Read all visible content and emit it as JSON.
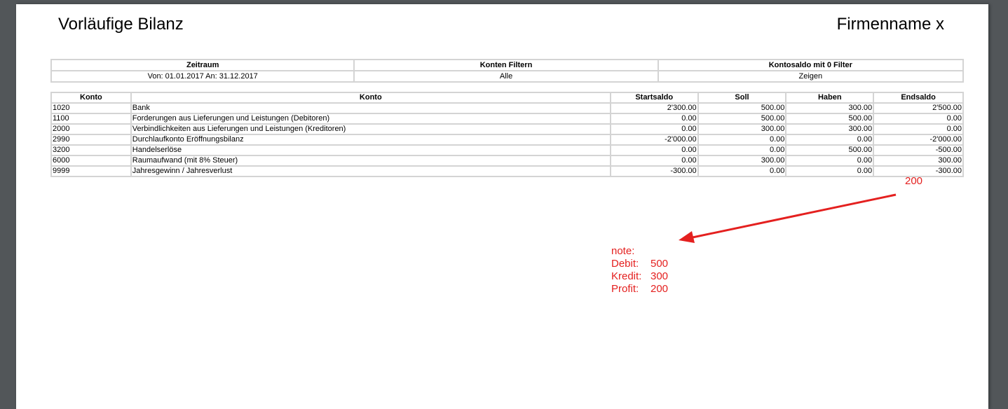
{
  "header": {
    "title": "Vorläufige Bilanz",
    "company": "Firmenname x"
  },
  "filters": {
    "headers": [
      "Zeitraum",
      "Konten Filtern",
      "Kontosaldo mit 0 Filter"
    ],
    "values": [
      "Von: 01.01.2017 An: 31.12.2017",
      "Alle",
      "Zeigen"
    ]
  },
  "accounts": {
    "headers": [
      "Konto",
      "Konto",
      "Startsaldo",
      "Soll",
      "Haben",
      "Endsaldo"
    ],
    "rows": [
      [
        "1020",
        "Bank",
        "2'300.00",
        "500.00",
        "300.00",
        "2'500.00"
      ],
      [
        "1100",
        "Forderungen aus Lieferungen und Leistungen (Debitoren)",
        "0.00",
        "500.00",
        "500.00",
        "0.00"
      ],
      [
        "2000",
        "Verbindlichkeiten aus Lieferungen und Leistungen (Kreditoren)",
        "0.00",
        "300.00",
        "300.00",
        "0.00"
      ],
      [
        "2990",
        "Durchlaufkonto Eröffnungsbilanz",
        "-2'000.00",
        "0.00",
        "0.00",
        "-2'000.00"
      ],
      [
        "3200",
        "Handelserlöse",
        "0.00",
        "0.00",
        "500.00",
        "-500.00"
      ],
      [
        "6000",
        "Raumaufwand (mit 8% Steuer)",
        "0.00",
        "300.00",
        "0.00",
        "300.00"
      ],
      [
        "9999",
        "Jahresgewinn / Jahresverlust",
        "-300.00",
        "0.00",
        "0.00",
        "-300.00"
      ]
    ]
  },
  "annotation": {
    "number": "200",
    "color": "#e4201f",
    "note_title": "note:",
    "lines": [
      {
        "label": "Debit:",
        "value": "500"
      },
      {
        "label": "Kredit:",
        "value": "300"
      },
      {
        "label": "Profit:",
        "value": "200"
      }
    ]
  }
}
